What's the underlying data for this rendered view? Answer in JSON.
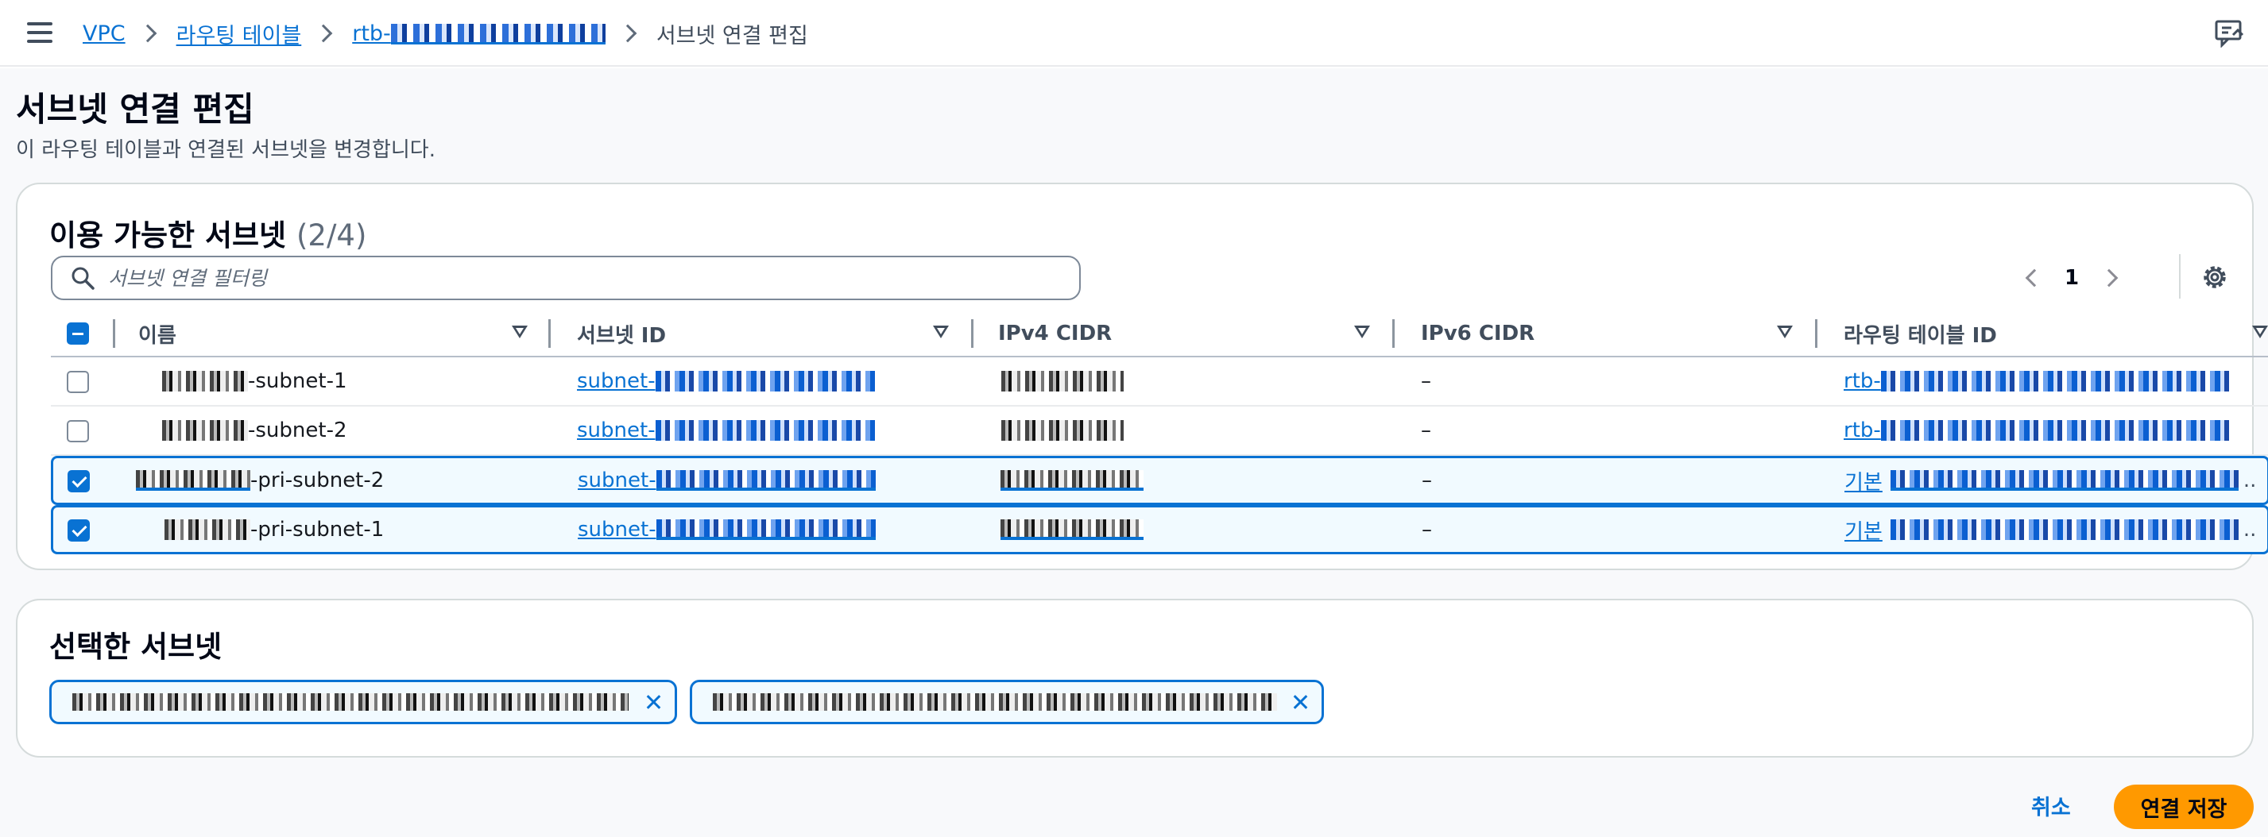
{
  "breadcrumb": {
    "items": [
      "VPC",
      "라우팅 테이블",
      "rtb-"
    ],
    "current": "서브넷 연결 편집"
  },
  "page": {
    "title": "서브넷 연결 편집",
    "description": "이 라우팅 테이블과 연결된 서브넷을 변경합니다."
  },
  "available": {
    "title": "이용 가능한 서브넷",
    "count": "(2/4)",
    "filter_placeholder": "서브넷 연결 필터링",
    "page_number": "1",
    "columns": [
      "이름",
      "서브넷 ID",
      "IPv4 CIDR",
      "IPv6 CIDR",
      "라우팅 테이블 ID"
    ],
    "rows": [
      {
        "name_suffix": "-subnet-1",
        "subnet_prefix": "subnet-",
        "ipv6": "–",
        "rtb_prefix": "rtb-",
        "selected": false
      },
      {
        "name_suffix": "-subnet-2",
        "subnet_prefix": "subnet-",
        "ipv6": "–",
        "rtb_prefix": "rtb-",
        "selected": false
      },
      {
        "name_suffix": "-pri-subnet-2",
        "subnet_prefix": "subnet-",
        "ipv6": "–",
        "rtb_prefix": "기본",
        "selected": true
      },
      {
        "name_suffix": "-pri-subnet-1",
        "subnet_prefix": "subnet-",
        "ipv6": "–",
        "rtb_prefix": "기본",
        "selected": true
      }
    ],
    "row_ellipsis": ".."
  },
  "selected_section": {
    "title": "선택한 서브넷"
  },
  "actions": {
    "cancel": "취소",
    "save": "연결 저장"
  },
  "colors": {
    "accent": "#0972d3",
    "primary_button": "#ff9900",
    "selected_row_bg": "#f1faff"
  },
  "icons": [
    "menu-icon",
    "chevron-right-icon",
    "feedback-icon",
    "search-icon",
    "chevron-left-icon",
    "settings-gear-icon",
    "sort-icon",
    "checkbox-icon",
    "close-icon"
  ]
}
